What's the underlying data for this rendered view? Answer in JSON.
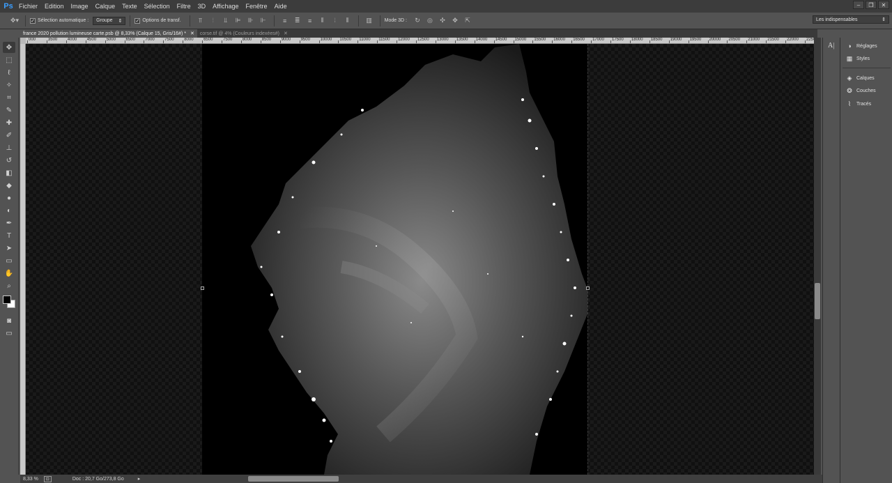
{
  "app": {
    "logo": "Ps"
  },
  "menu": [
    "Fichier",
    "Edition",
    "Image",
    "Calque",
    "Texte",
    "Sélection",
    "Filtre",
    "3D",
    "Affichage",
    "Fenêtre",
    "Aide"
  ],
  "window_controls": {
    "minimize": "–",
    "restore": "❐",
    "close": "✕"
  },
  "options_bar": {
    "auto_select_label": "Sélection automatique :",
    "auto_select_checked": true,
    "group_select": "Groupe",
    "transform_label": "Options de transf.",
    "transform_checked": true,
    "mode3d_label": "Mode 3D :",
    "workspace": "Les indispensables"
  },
  "tabs": [
    {
      "label": "france 2020 pollution lumineuse carte.psb @ 8,33% (Calque 15, Gris/16#) *",
      "close": "✕",
      "active": true
    },
    {
      "label": "corse.tif @ 4% (Couleurs indexées#)",
      "close": "✕",
      "active": false
    }
  ],
  "ruler_top_labels": [
    "000",
    "3500",
    "4000",
    "4500",
    "5000",
    "6500",
    "7000",
    "7500",
    "8000",
    "6500",
    "7500",
    "8000",
    "8500",
    "9000",
    "9500",
    "10000",
    "10500",
    "11000",
    "11500",
    "12000",
    "12500",
    "13000",
    "13500",
    "14000",
    "14500",
    "15000",
    "15500",
    "16000",
    "16500",
    "17000",
    "17500",
    "18000",
    "18500",
    "19000",
    "19500",
    "20000",
    "20500",
    "21000",
    "21500",
    "22000",
    "22500",
    "2300"
  ],
  "tools": [
    {
      "name": "move-tool",
      "glyph": "✥"
    },
    {
      "name": "marquee-tool",
      "glyph": "⬚"
    },
    {
      "name": "lasso-tool",
      "glyph": "ℓ"
    },
    {
      "name": "magic-wand-tool",
      "glyph": "✧"
    },
    {
      "name": "crop-tool",
      "glyph": "⌗"
    },
    {
      "name": "eyedropper-tool",
      "glyph": "✎"
    },
    {
      "name": "healing-brush-tool",
      "glyph": "✚"
    },
    {
      "name": "brush-tool",
      "glyph": "✐"
    },
    {
      "name": "clone-stamp-tool",
      "glyph": "⊥"
    },
    {
      "name": "history-brush-tool",
      "glyph": "↺"
    },
    {
      "name": "eraser-tool",
      "glyph": "◧"
    },
    {
      "name": "paint-bucket-tool",
      "glyph": "◆"
    },
    {
      "name": "blur-tool",
      "glyph": "●"
    },
    {
      "name": "dodge-tool",
      "glyph": "◐"
    },
    {
      "name": "pen-tool",
      "glyph": "✒"
    },
    {
      "name": "type-tool",
      "glyph": "T"
    },
    {
      "name": "path-selection-tool",
      "glyph": "➤"
    },
    {
      "name": "rectangle-tool",
      "glyph": "▭"
    },
    {
      "name": "hand-tool",
      "glyph": "✋"
    },
    {
      "name": "zoom-tool",
      "glyph": "⌕"
    }
  ],
  "status": {
    "zoom": "8,33 %",
    "doc": "Doc : 20,7 Go/273,8 Go"
  },
  "right_panels": {
    "char_icon": "A|",
    "items": [
      {
        "label": "Réglages",
        "glyph": "◑"
      },
      {
        "label": "Styles",
        "glyph": "▦"
      },
      {
        "label": "Calques",
        "glyph": "◈"
      },
      {
        "label": "Couches",
        "glyph": "❂"
      },
      {
        "label": "Tracés",
        "glyph": "⌇"
      }
    ]
  },
  "colors": {
    "accent": "#3b9eff",
    "chrome": "#535353",
    "canvas": "#000000"
  }
}
